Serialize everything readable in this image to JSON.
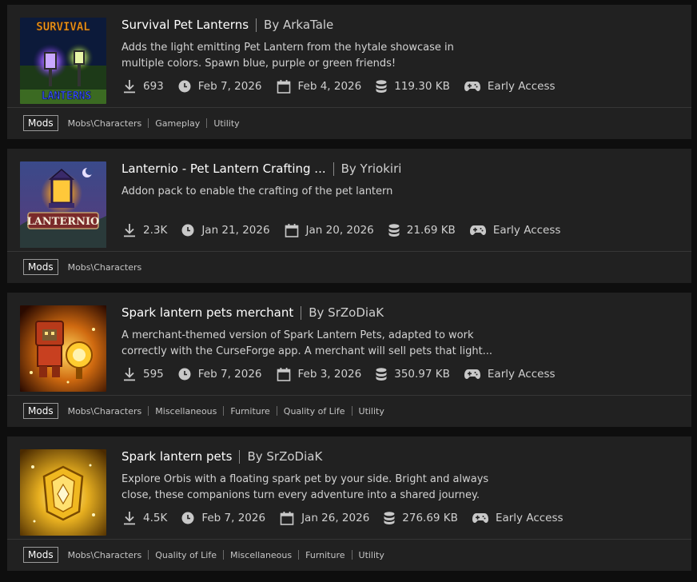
{
  "mods": [
    {
      "title": "Survival Pet Lanterns",
      "author": "By ArkaTale",
      "description": "Adds the light emitting Pet Lantern from the hytale showcase in multiple colors. Spawn blue, purple or green friends!",
      "downloads": "693",
      "updated": "Feb 7, 2026",
      "created": "Feb 4, 2026",
      "size": "119.30 KB",
      "status": "Early Access",
      "main_tag": "Mods",
      "tags": [
        "Mobs\\Characters",
        "Gameplay",
        "Utility"
      ],
      "thumb_text": [
        "SURVIVAL",
        "LANTERNS"
      ]
    },
    {
      "title": "Lanternio - Pet Lantern Crafting ...",
      "author": "By Yriokiri",
      "description": "Addon pack to enable the crafting of the pet lantern",
      "downloads": "2.3K",
      "updated": "Jan 21, 2026",
      "created": "Jan 20, 2026",
      "size": "21.69 KB",
      "status": "Early Access",
      "main_tag": "Mods",
      "tags": [
        "Mobs\\Characters"
      ],
      "thumb_text": [
        "LANTERNIO"
      ]
    },
    {
      "title": "Spark lantern pets merchant",
      "author": "By SrZoDiaK",
      "description": "A merchant-themed version of Spark Lantern Pets, adapted to work correctly with the CurseForge app. A merchant will sell pets that light...",
      "downloads": "595",
      "updated": "Feb 7, 2026",
      "created": "Feb 3, 2026",
      "size": "350.97 KB",
      "status": "Early Access",
      "main_tag": "Mods",
      "tags": [
        "Mobs\\Characters",
        "Miscellaneous",
        "Furniture",
        "Quality of Life",
        "Utility"
      ],
      "thumb_text": []
    },
    {
      "title": "Spark lantern pets",
      "author": "By SrZoDiaK",
      "description": "Explore Orbis with a floating spark pet by your side. Bright and always close, these companions turn every adventure into a shared journey.",
      "downloads": "4.5K",
      "updated": "Feb 7, 2026",
      "created": "Jan 26, 2026",
      "size": "276.69 KB",
      "status": "Early Access",
      "main_tag": "Mods",
      "tags": [
        "Mobs\\Characters",
        "Quality of Life",
        "Miscellaneous",
        "Furniture",
        "Utility"
      ],
      "thumb_text": []
    }
  ],
  "colors": {
    "background": "#0e0e0e",
    "card": "#212121",
    "title": "#ffffff",
    "text": "#d2d2d2"
  },
  "icons": [
    "download-icon",
    "clock-icon",
    "calendar-icon",
    "database-icon",
    "gamepad-icon"
  ]
}
